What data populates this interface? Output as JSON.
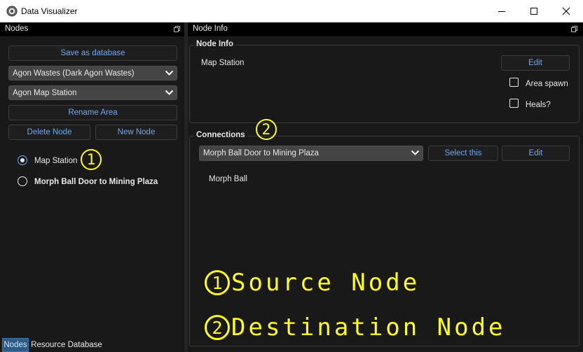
{
  "window": {
    "title": "Data Visualizer"
  },
  "nodes_panel": {
    "title": "Nodes",
    "save_label": "Save as database",
    "region_combo": "Agon Wastes (Dark Agon Wastes)",
    "area_combo": "Agon Map Station",
    "rename_label": "Rename Area",
    "delete_label": "Delete Node",
    "new_label": "New Node",
    "nodes": [
      {
        "label": "Map Station",
        "selected": true
      },
      {
        "label": "Morph Ball Door to Mining Plaza",
        "selected": false
      }
    ]
  },
  "node_info_panel": {
    "title": "Node Info",
    "group_title": "Node Info",
    "node_name": "Map Station",
    "edit_label": "Edit",
    "area_spawn_label": "Area spawn",
    "area_spawn_checked": false,
    "heals_label": "Heals?",
    "heals_checked": false
  },
  "connections": {
    "group_title": "Connections",
    "target_combo": "Morph Ball Door to Mining Plaza",
    "select_label": "Select this",
    "edit_label": "Edit",
    "requirement": "Morph Ball"
  },
  "tabs": [
    {
      "label": "Nodes",
      "active": true
    },
    {
      "label": "Resource Database",
      "active": false
    }
  ],
  "annotations": {
    "marker_1": "1",
    "marker_2": "2",
    "legend_1_number": "1",
    "legend_1_text": "Source Node",
    "legend_2_number": "2",
    "legend_2_text": "Destination Node"
  },
  "colors": {
    "accent_text": "#6fa8f0",
    "annotation_yellow": "#ffff1e",
    "background": "#191919"
  }
}
